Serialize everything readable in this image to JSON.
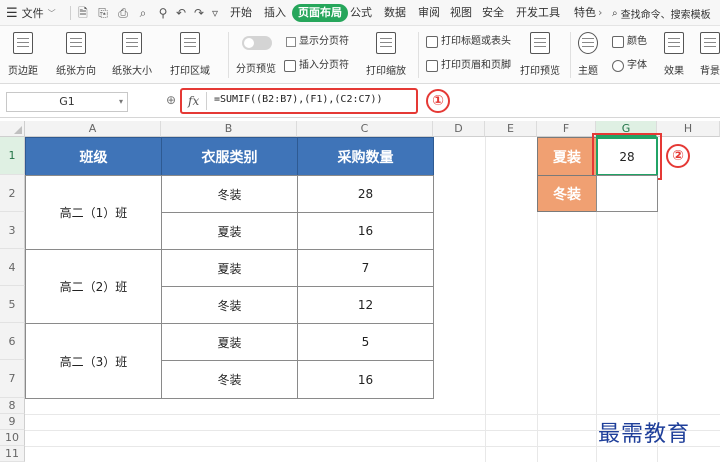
{
  "menu": {
    "file_label": "文件",
    "tabs": [
      "开始",
      "插入",
      "页面布局",
      "公式",
      "数据",
      "审阅",
      "视图",
      "安全",
      "开发工具",
      "特色"
    ],
    "active_tab": "页面布局",
    "search_label": "查找命令、搜索模板"
  },
  "ribbon": {
    "margins": "页边距",
    "orientation": "纸张方向",
    "paper_size": "纸张大小",
    "print_area": "打印区域",
    "page_break_preview": "分页预览",
    "show_page_breaks": "显示分页符",
    "insert_page_break": "插入分页符",
    "print_scale": "打印缩放",
    "print_titles": "打印标题或表头",
    "print_header_footer": "打印页眉和页脚",
    "print_preview": "打印预览",
    "theme": "主题",
    "colors": "颜色",
    "fonts": "字体",
    "effects": "效果",
    "background": "背景"
  },
  "formula_bar": {
    "name_box": "G1",
    "fx": "fx",
    "formula": "=SUMIF((B2:B7),(F1),(C2:C7))"
  },
  "annotations": {
    "one": "①",
    "two": "②"
  },
  "columns": [
    "A",
    "B",
    "C",
    "D",
    "E",
    "F",
    "G",
    "H"
  ],
  "rows": [
    "1",
    "2",
    "3",
    "4",
    "5",
    "6",
    "7",
    "8",
    "9",
    "10",
    "11"
  ],
  "table": {
    "headers": [
      "班级",
      "衣服类别",
      "采购数量"
    ],
    "groups": [
      {
        "class": "高二（1）班",
        "items": [
          {
            "type": "冬装",
            "qty": "28"
          },
          {
            "type": "夏装",
            "qty": "16"
          }
        ]
      },
      {
        "class": "高二（2）班",
        "items": [
          {
            "type": "夏装",
            "qty": "7"
          },
          {
            "type": "冬装",
            "qty": "12"
          }
        ]
      },
      {
        "class": "高二（3）班",
        "items": [
          {
            "type": "夏装",
            "qty": "5"
          },
          {
            "type": "冬装",
            "qty": "16"
          }
        ]
      }
    ]
  },
  "side": {
    "f1": "夏装",
    "g1": "28",
    "f2": "冬装",
    "g2": ""
  },
  "watermark": "最需教育",
  "colors": {
    "header_blue": "#3f74b8",
    "orange": "#f0a072",
    "annotation_red": "#e53935",
    "active_tab_green": "#26a65b"
  }
}
